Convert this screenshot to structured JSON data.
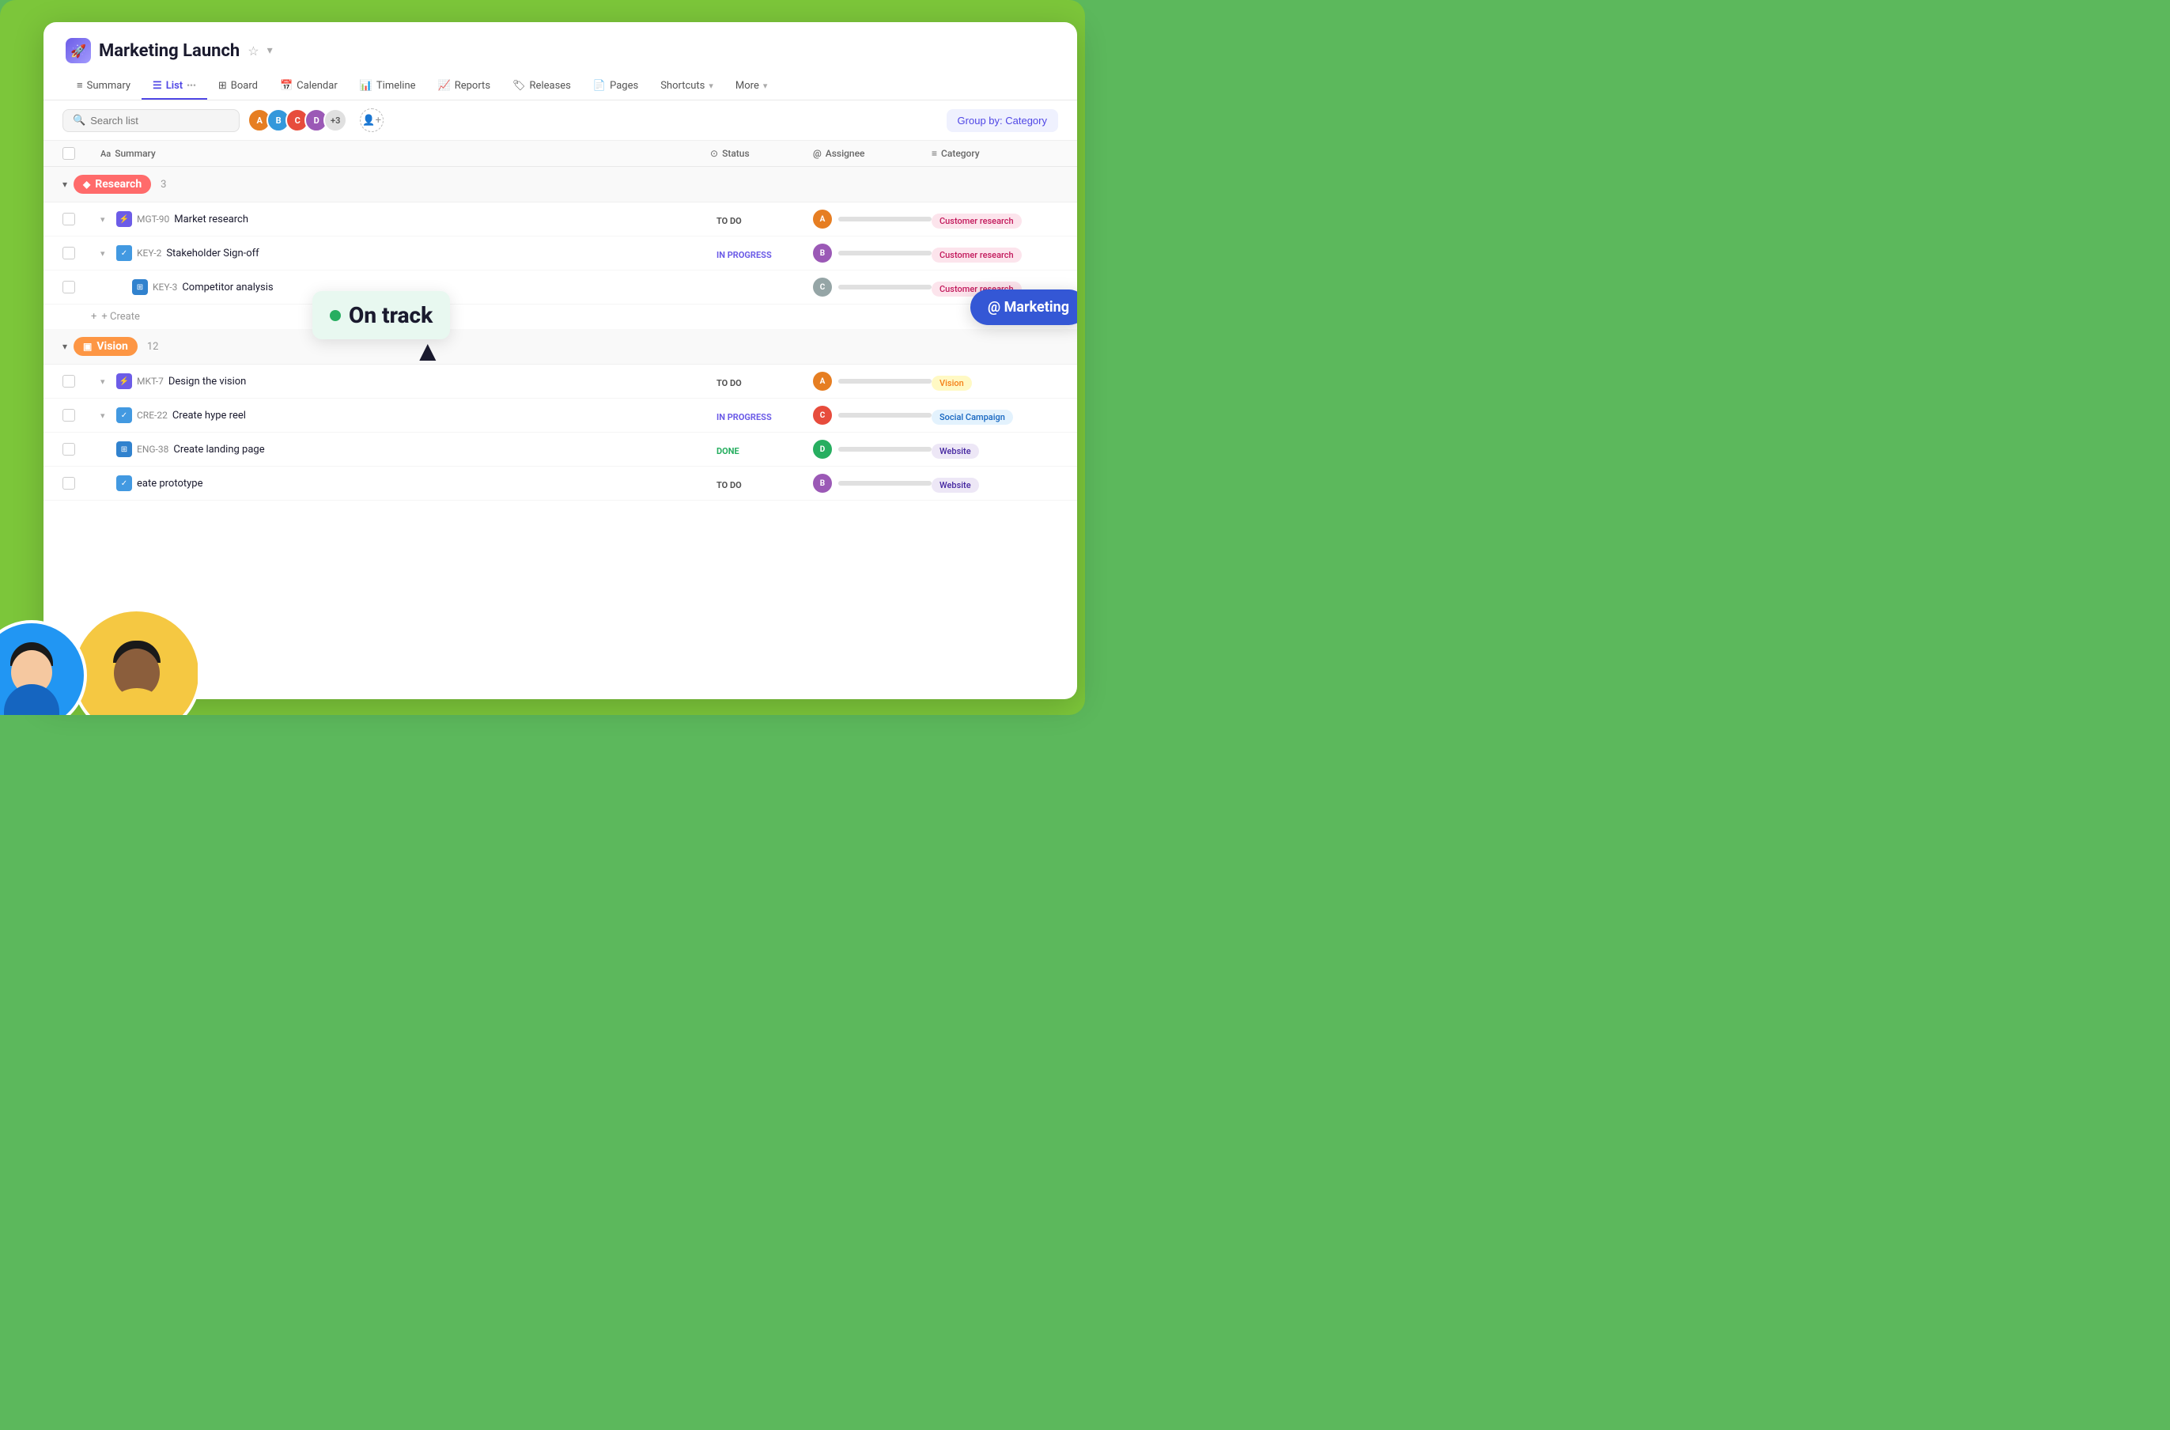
{
  "app": {
    "title": "Marketing Launch",
    "icon": "🚀"
  },
  "nav": {
    "tabs": [
      {
        "label": "Summary",
        "icon": "≡",
        "active": false
      },
      {
        "label": "List",
        "icon": "☰",
        "active": true
      },
      {
        "label": "Board",
        "icon": "⊞",
        "active": false
      },
      {
        "label": "Calendar",
        "icon": "📅",
        "active": false
      },
      {
        "label": "Timeline",
        "icon": "📊",
        "active": false
      },
      {
        "label": "Reports",
        "icon": "📈",
        "active": false
      },
      {
        "label": "Releases",
        "icon": "🏷",
        "active": false
      },
      {
        "label": "Pages",
        "icon": "📄",
        "active": false
      },
      {
        "label": "Shortcuts",
        "icon": "",
        "active": false
      },
      {
        "label": "More",
        "icon": "",
        "active": false
      }
    ]
  },
  "toolbar": {
    "search_placeholder": "Search list",
    "avatar_count": "+3",
    "group_by_label": "Group by: Category"
  },
  "table": {
    "headers": {
      "summary": "Summary",
      "status": "Status",
      "assignee": "Assignee",
      "category": "Category"
    }
  },
  "sections": [
    {
      "id": "research",
      "label": "Research",
      "count": "3",
      "color": "research",
      "tasks": [
        {
          "id": "MGT-90",
          "title": "Market research",
          "status": "TO DO",
          "status_class": "status-todo",
          "icon_class": "icon-purple",
          "icon": "⚡",
          "assignee_color": "#e67e22",
          "category": "Customer research",
          "cat_class": "cat-customer-research",
          "indent": 1,
          "has_expand": true
        },
        {
          "id": "KEY-2",
          "title": "Stakeholder Sign-off",
          "status": "IN PROGRESS",
          "status_class": "status-in-progress",
          "icon_class": "icon-blue",
          "icon": "✓",
          "assignee_color": "#9b59b6",
          "category": "Customer research",
          "cat_class": "cat-customer-research",
          "indent": 1,
          "has_expand": true
        },
        {
          "id": "KEY-3",
          "title": "Competitor analysis",
          "status": "",
          "status_class": "",
          "icon_class": "icon-blue-sq",
          "icon": "⊞",
          "assignee_color": "#7f8c8d",
          "category": "Customer research",
          "cat_class": "cat-customer-research",
          "indent": 2,
          "has_expand": false
        }
      ],
      "create_label": "+ Create"
    },
    {
      "id": "vision",
      "label": "Vision",
      "count": "12",
      "color": "vision",
      "tasks": [
        {
          "id": "MKT-7",
          "title": "Design the vision",
          "status": "TO DO",
          "status_class": "status-todo",
          "icon_class": "icon-purple",
          "icon": "⚡",
          "assignee_color": "#e67e22",
          "category": "Vision",
          "cat_class": "cat-vision",
          "indent": 1,
          "has_expand": true
        },
        {
          "id": "CRE-22",
          "title": "Create hype reel",
          "status": "IN PROGRESS",
          "status_class": "status-in-progress",
          "icon_class": "icon-blue",
          "icon": "✓",
          "assignee_color": "#e74c3c",
          "category": "Social Campaign",
          "cat_class": "cat-social",
          "indent": 1,
          "has_expand": true
        },
        {
          "id": "ENG-38",
          "title": "Create landing page",
          "status": "DONE",
          "status_class": "status-done",
          "icon_class": "icon-blue-sq",
          "icon": "⊞",
          "assignee_color": "#27ae60",
          "category": "Website",
          "cat_class": "cat-website",
          "indent": 1,
          "has_expand": false
        },
        {
          "id": "",
          "title": "eate prototype",
          "status": "TO DO",
          "status_class": "status-todo",
          "icon_class": "icon-blue",
          "icon": "✓",
          "assignee_color": "#9b59b6",
          "category": "Website",
          "cat_class": "cat-website",
          "indent": 1,
          "has_expand": false
        }
      ]
    }
  ],
  "tooltip": {
    "on_track": "On track",
    "at_marketing": "@ Marketing"
  },
  "shortcuts_label": "Shortcuts"
}
